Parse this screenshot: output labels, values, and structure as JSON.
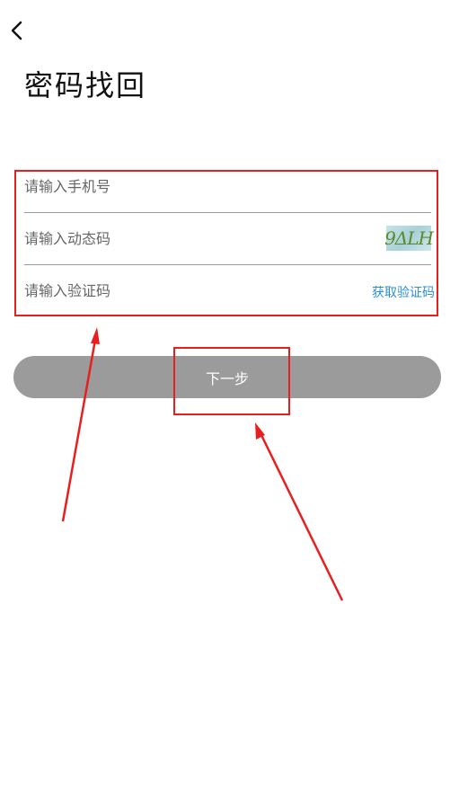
{
  "header": {
    "back_icon": "chevron-left-icon",
    "title": "密码找回"
  },
  "form": {
    "phone_placeholder": "请输入手机号",
    "dynamic_code_placeholder": "请输入动态码",
    "captcha_text": "9ΔLH",
    "verify_code_placeholder": "请输入验证码",
    "get_code_label": "获取验证码"
  },
  "actions": {
    "next_label": "下一步"
  },
  "colors": {
    "button_bg": "#9b9b9b",
    "link": "#2a8fd8",
    "annotation": "#e81f1f"
  }
}
